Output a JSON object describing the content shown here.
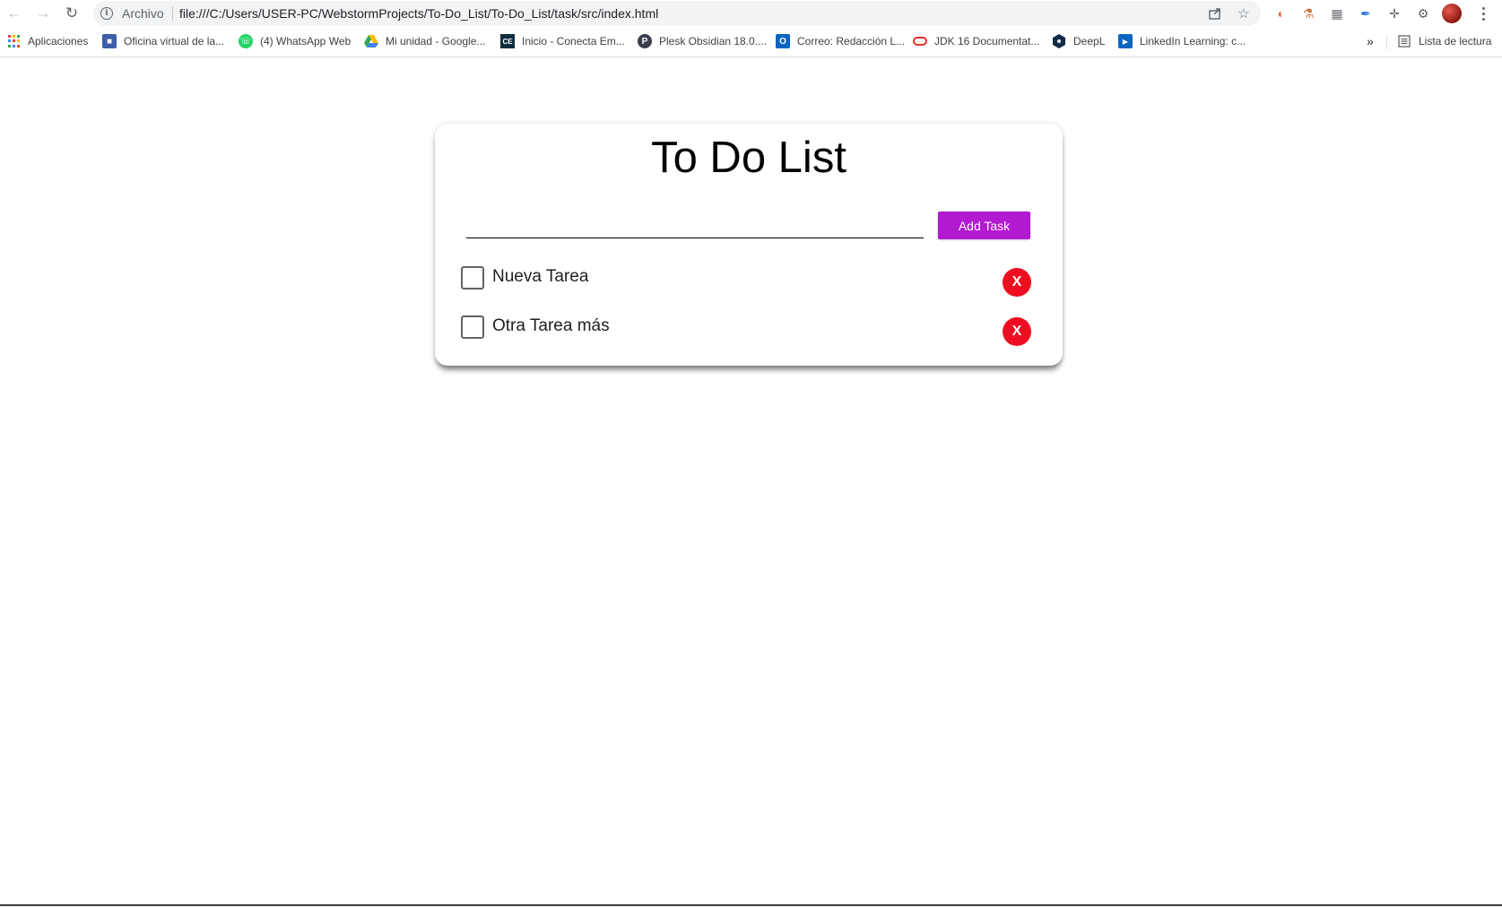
{
  "browser": {
    "address_scheme": "Archivo",
    "url": "file:///C:/Users/USER-PC/WebstormProjects/To-Do_List/To-Do_List/task/src/index.html",
    "bookmarks": [
      {
        "label": "Aplicaciones",
        "icon": "apps-grid-icon"
      },
      {
        "label": "Oficina virtual de la...",
        "icon": "office-icon",
        "color": "#3b5fa8"
      },
      {
        "label": "(4) WhatsApp Web",
        "icon": "whatsapp-icon",
        "color": "#25d366"
      },
      {
        "label": "Mi unidad - Google...",
        "icon": "google-drive-icon",
        "color": "#f4b400"
      },
      {
        "label": "Inicio - Conecta Em...",
        "icon": "ce-icon",
        "color": "#0f2d3c",
        "glyph": "CE"
      },
      {
        "label": "Plesk Obsidian 18.0....",
        "icon": "plesk-icon",
        "color": "#3a3f4b",
        "glyph": "P"
      },
      {
        "label": "Correo: Redacción L...",
        "icon": "outlook-icon",
        "color": "#0a64c2",
        "glyph": "O"
      },
      {
        "label": "JDK 16 Documentat...",
        "icon": "oracle-icon",
        "color": "#e0312a"
      },
      {
        "label": "DeepL",
        "icon": "deepl-icon",
        "color": "#0f2b46"
      },
      {
        "label": "LinkedIn Learning: c...",
        "icon": "linkedin-learning-icon",
        "color": "#0a66c2"
      }
    ],
    "reading_list": "Lista de lectura"
  },
  "app": {
    "title": "To Do List",
    "input_value": "",
    "add_button_label": "Add Task",
    "tasks": [
      {
        "label": "Nueva Tarea",
        "checked": false,
        "delete_label": "X"
      },
      {
        "label": "Otra Tarea más",
        "checked": false,
        "delete_label": "X"
      }
    ]
  },
  "colors": {
    "add_button": "#b21ad2",
    "delete_button": "#ee0e22"
  }
}
